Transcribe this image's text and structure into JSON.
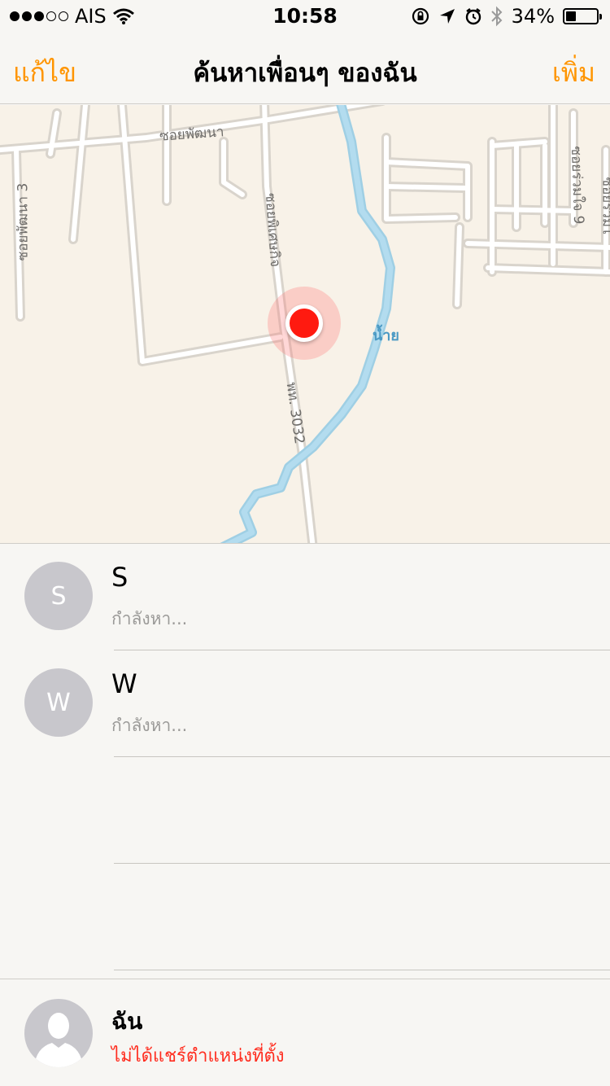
{
  "status_bar": {
    "carrier": "AIS",
    "time": "10:58",
    "battery_percent_text": "34%",
    "battery_level": 0.34,
    "signal_bars_filled": 3,
    "signal_bars_total": 5
  },
  "nav": {
    "edit_label": "แก้ไข",
    "title": "ค้นหาเพื่อนๆ ของฉัน",
    "add_label": "เพิ่ม"
  },
  "map": {
    "road_labels": {
      "soi_phatthana": "ซอยพัฒนา",
      "soi_phatthana_3": "ซอยพัฒนา 3",
      "soi_phisetkit": "ซอยพิเศษกิจ",
      "route_3032": "พท. 3032",
      "soi_ruamjai_9": "ซอยร่วมใจ 9",
      "soi_ruamjai_edge": "ซอยร่วมใ"
    },
    "river_label": "น้ำย"
  },
  "friends": [
    {
      "initial": "S",
      "name": "S",
      "status": "กำลังหา..."
    },
    {
      "initial": "W",
      "name": "W",
      "status": "กำลังหา..."
    }
  ],
  "me": {
    "name": "ฉัน",
    "status": "ไม่ได้แชร์ตำแหน่งที่ตั้ง"
  },
  "colors": {
    "accent": "#ff9500",
    "warning": "#ff2d1f",
    "pin": "#ff1a10",
    "river": "#a8d8ec",
    "map_land": "#f8f2e8"
  },
  "icons": {
    "wifi": "wifi-icon",
    "rotation_lock": "rotation-lock-icon",
    "location": "location-arrow-icon",
    "alarm": "alarm-icon",
    "bluetooth": "bluetooth-icon",
    "battery": "battery-icon"
  }
}
